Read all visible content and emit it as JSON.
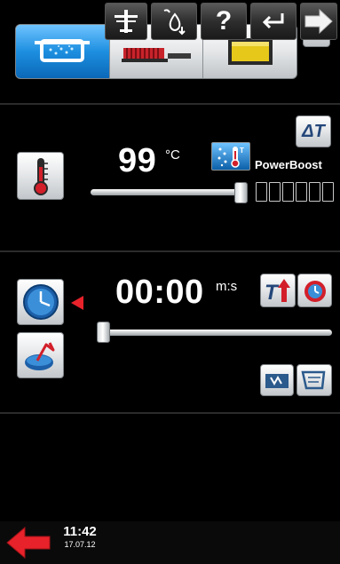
{
  "colors": {
    "active_mode": "#1d8fe0",
    "accent_red": "#e8222a",
    "background": "#000000"
  },
  "modes": [
    {
      "name": "steam-mode",
      "icon": "steam-pot-icon",
      "active": true
    },
    {
      "name": "grill-mode",
      "icon": "grill-pan-icon",
      "active": false
    },
    {
      "name": "fry-mode",
      "icon": "fryer-basin-icon",
      "active": false
    }
  ],
  "temperature": {
    "value": "99",
    "unit": "°C",
    "icon": "thermometer-icon",
    "slider_level_percent": 100,
    "delta_t_label": "ΔT",
    "powerboost_label": "PowerBoost",
    "powerboost_level": 0,
    "powerboost_max": 6
  },
  "timer": {
    "value": "00:00",
    "unit": "m:s",
    "icon": "clock-icon",
    "slider_level_percent": 0
  },
  "statusbar": {
    "time": "11:42",
    "date": "17.07.12"
  },
  "bottom_buttons": [
    {
      "name": "back-button",
      "icon": "red-arrow-left-icon"
    },
    {
      "name": "core-probe-button",
      "icon": "probe-icon"
    },
    {
      "name": "water-button",
      "icon": "water-drop-icon"
    },
    {
      "name": "help-button",
      "icon": "question-mark-icon",
      "label": "?"
    },
    {
      "name": "undo-button",
      "icon": "undo-arrow-icon"
    },
    {
      "name": "next-button",
      "icon": "arrow-right-icon"
    }
  ]
}
